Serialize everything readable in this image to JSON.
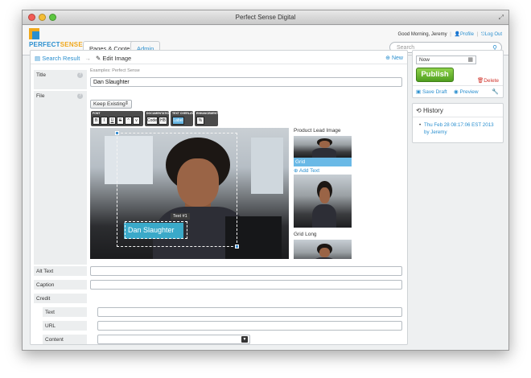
{
  "window": {
    "title": "Perfect Sense Digital"
  },
  "header": {
    "logo": {
      "left": "PERFECT",
      "right": "SENSE"
    },
    "tabs": [
      {
        "label": "Pages & Content"
      },
      {
        "label": "Admin"
      }
    ],
    "greeting": "Good Morning, Jeremy",
    "profile_label": "Profile",
    "logout_label": "Log Out",
    "search_placeholder": "Search"
  },
  "breadcrumb": {
    "back_label": "Search Result",
    "current": "Edit Image"
  },
  "new_label": "New",
  "form": {
    "title": {
      "label": "Title",
      "hint": "Examples: Perfect Sense",
      "value": "Dan Slaughter"
    },
    "file": {
      "label": "File",
      "select_value": "Keep Existing"
    },
    "alt_text": {
      "label": "Alt Text",
      "value": ""
    },
    "caption": {
      "label": "Caption",
      "value": ""
    },
    "credit": {
      "label": "Credit"
    },
    "credit_text": {
      "label": "Text",
      "value": ""
    },
    "credit_url": {
      "label": "URL",
      "value": ""
    },
    "credit_content": {
      "label": "Content",
      "value": ""
    }
  },
  "toolbar": {
    "groups": [
      {
        "label": "FONT",
        "buttons": [
          "B",
          "I",
          "U",
          "S",
          "^",
          "v"
        ]
      },
      {
        "label": "DOCUMENTATION",
        "buttons": [
          "Code",
          "HB"
        ]
      },
      {
        "label": "TEXT OVERLAY",
        "buttons": [
          "Label"
        ]
      },
      {
        "label": "ENHANCEMENT",
        "buttons": [
          "%"
        ]
      }
    ]
  },
  "editor": {
    "text_tag": "Text #1",
    "overlay_text": "Dan Slaughter"
  },
  "sizes": {
    "heading": "Product Lead Image",
    "grid_label": "Grid",
    "add_text_label": "Add Text",
    "grid_long_label": "Grid Long"
  },
  "publish": {
    "date_value": "Now",
    "button_label": "Publish",
    "delete_label": "Delete",
    "save_draft_label": "Save Draft",
    "preview_label": "Preview"
  },
  "history": {
    "title": "History",
    "items": [
      {
        "label": "Thu Feb 28 08:17:06 EST 2013 by Jeremy"
      }
    ]
  },
  "colors": {
    "accent": "#2a8fcf",
    "publish_green": "#5aae26",
    "delete_red": "#d0342c",
    "overlay_teal": "#3aa9c9",
    "selected_blue": "#6ab9e6"
  }
}
